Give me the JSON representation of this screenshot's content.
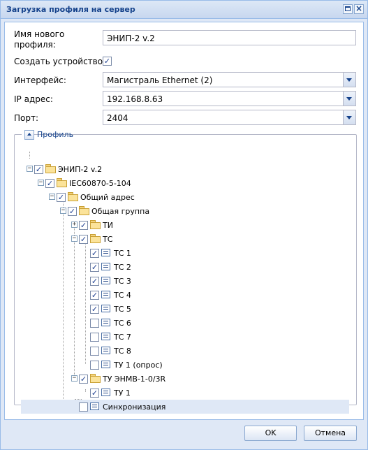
{
  "window": {
    "title": "Загрузка профиля на сервер"
  },
  "form": {
    "profile_name_label": "Имя нового\nпрофиля:",
    "profile_name_value": "ЭНИП-2 v.2",
    "create_device_label": "Создать устройство:",
    "create_device_checked": "✓",
    "interface_label": "Интерфейс:",
    "interface_value": "Магистраль Ethernet (2)",
    "ip_label": "IP адрес:",
    "ip_value": "192.168.8.63",
    "port_label": "Порт:",
    "port_value": "2404"
  },
  "profile_section": {
    "legend": "Профиль"
  },
  "tree": [
    {
      "label": "ЭНИП-2 v.2",
      "checked": "✓"
    },
    {
      "label": "IEC60870-5-104",
      "checked": "✓"
    },
    {
      "label": "Общий адрес",
      "checked": "✓"
    },
    {
      "label": "Общая группа",
      "checked": "✓"
    },
    {
      "label": "ТИ",
      "checked": "✓"
    },
    {
      "label": "ТС",
      "checked": "✓"
    },
    {
      "label": "ТС 1",
      "checked": "✓"
    },
    {
      "label": "ТС 2",
      "checked": "✓"
    },
    {
      "label": "ТС 3",
      "checked": "✓"
    },
    {
      "label": "ТС 4",
      "checked": "✓"
    },
    {
      "label": "ТС 5",
      "checked": "✓"
    },
    {
      "label": "ТС 6",
      "checked": ""
    },
    {
      "label": "ТС 7",
      "checked": ""
    },
    {
      "label": "ТС 8",
      "checked": ""
    },
    {
      "label": "ТУ 1 (опрос)",
      "checked": ""
    },
    {
      "label": "ТУ ЭНМВ-1-0/3R",
      "checked": "✓"
    },
    {
      "label": "ТУ 1",
      "checked": "✓"
    },
    {
      "label": "Синхронизация",
      "checked": ""
    }
  ],
  "buttons": {
    "ok": "OK",
    "cancel": "Отмена"
  },
  "icons": {
    "minus": "−",
    "plus": "+",
    "close": "×"
  }
}
